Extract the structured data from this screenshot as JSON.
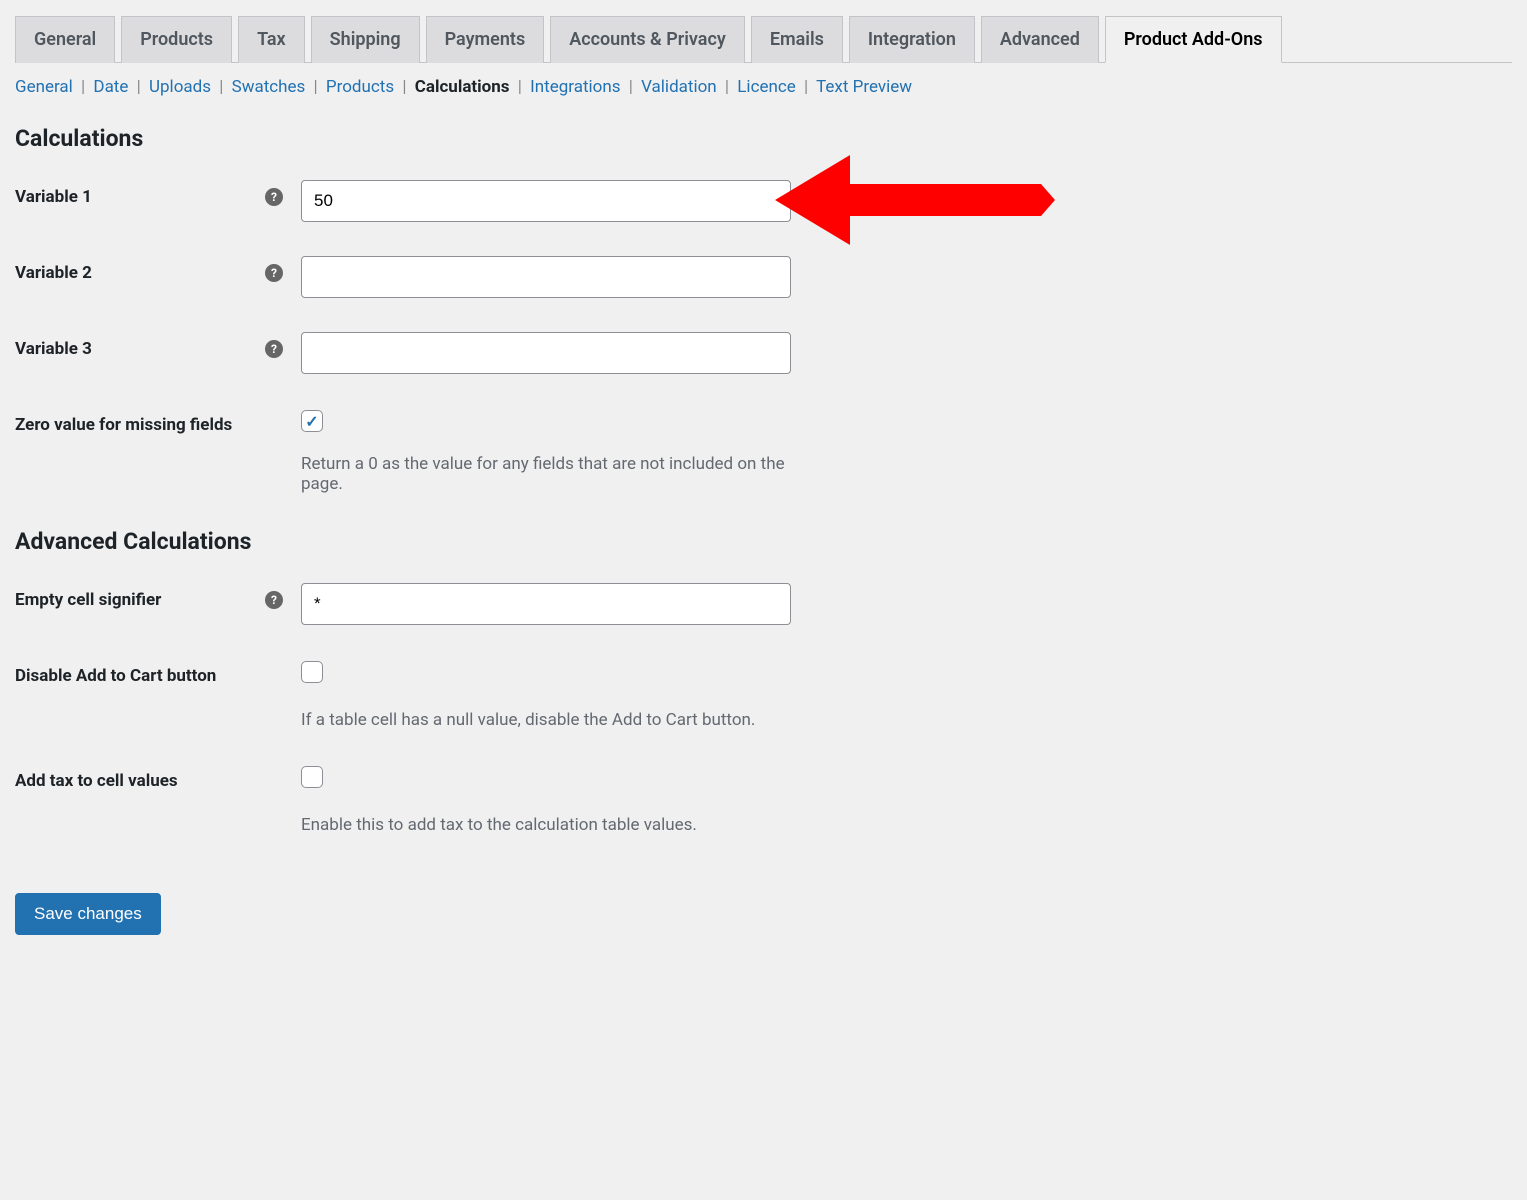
{
  "tabs": [
    {
      "label": "General",
      "active": false
    },
    {
      "label": "Products",
      "active": false
    },
    {
      "label": "Tax",
      "active": false
    },
    {
      "label": "Shipping",
      "active": false
    },
    {
      "label": "Payments",
      "active": false
    },
    {
      "label": "Accounts & Privacy",
      "active": false
    },
    {
      "label": "Emails",
      "active": false
    },
    {
      "label": "Integration",
      "active": false
    },
    {
      "label": "Advanced",
      "active": false
    },
    {
      "label": "Product Add-Ons",
      "active": true
    }
  ],
  "subnav": [
    {
      "label": "General",
      "current": false
    },
    {
      "label": "Date",
      "current": false
    },
    {
      "label": "Uploads",
      "current": false
    },
    {
      "label": "Swatches",
      "current": false
    },
    {
      "label": "Products",
      "current": false
    },
    {
      "label": "Calculations",
      "current": true
    },
    {
      "label": "Integrations",
      "current": false
    },
    {
      "label": "Validation",
      "current": false
    },
    {
      "label": "Licence",
      "current": false
    },
    {
      "label": "Text Preview",
      "current": false
    }
  ],
  "sections": {
    "calculations": {
      "heading": "Calculations",
      "variable1": {
        "label": "Variable 1",
        "value": "50"
      },
      "variable2": {
        "label": "Variable 2",
        "value": ""
      },
      "variable3": {
        "label": "Variable 3",
        "value": ""
      },
      "zero_value": {
        "label": "Zero value for missing fields",
        "checked": true,
        "desc": "Return a 0 as the value for any fields that are not included on the page."
      }
    },
    "advanced": {
      "heading": "Advanced Calculations",
      "empty_cell": {
        "label": "Empty cell signifier",
        "value": "*"
      },
      "disable_cart": {
        "label": "Disable Add to Cart button",
        "checked": false,
        "desc": "If a table cell has a null value, disable the Add to Cart button."
      },
      "add_tax": {
        "label": "Add tax to cell values",
        "checked": false,
        "desc": "Enable this to add tax to the calculation table values."
      }
    }
  },
  "save_button": "Save changes",
  "annotation": {
    "arrow_color": "#ff0000"
  }
}
